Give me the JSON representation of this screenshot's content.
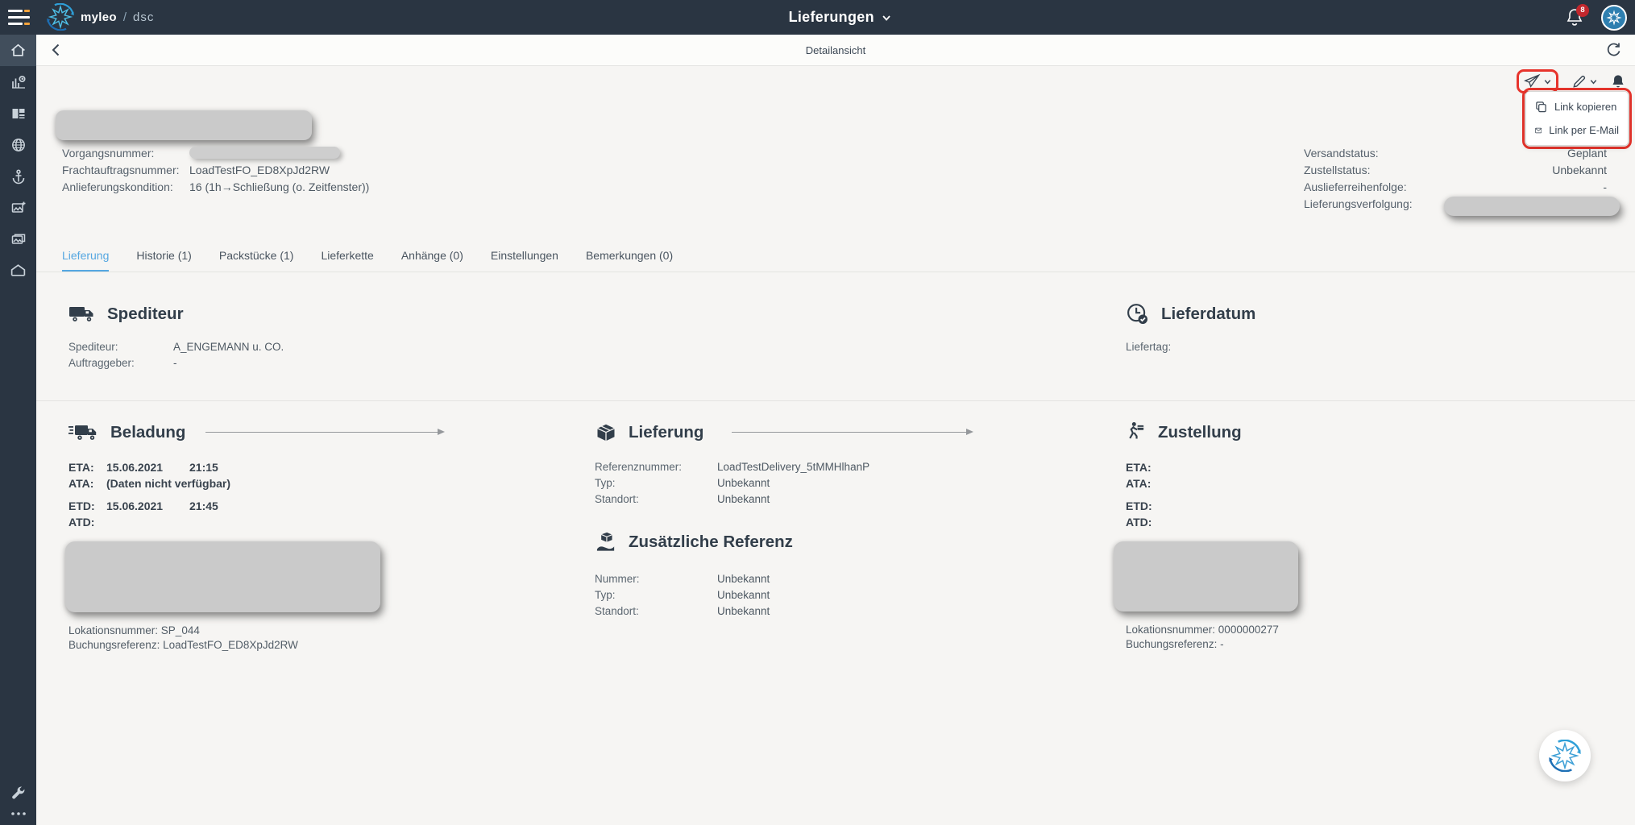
{
  "colors": {
    "topbar_bg": "#2a3542",
    "accent_blue": "#55a7e1",
    "annotation_red": "#e7342c",
    "badge_red": "#c1272d",
    "brand_orange": "#f2a33c"
  },
  "topbar": {
    "brand_name": "myleo",
    "brand_sep": "/",
    "brand_product": "dsc",
    "title": "Lieferungen",
    "notifications_count": "8"
  },
  "sidebar": {
    "items": [
      {
        "name": "home"
      },
      {
        "name": "analytics"
      },
      {
        "name": "boards"
      },
      {
        "name": "globe"
      },
      {
        "name": "anchor"
      },
      {
        "name": "image-add"
      },
      {
        "name": "gallery"
      },
      {
        "name": "warehouse"
      }
    ]
  },
  "subheader": {
    "title": "Detailansicht"
  },
  "share_menu": {
    "items": [
      {
        "label": "Link kopieren"
      },
      {
        "label": "Link per E-Mail"
      }
    ]
  },
  "info": {
    "left": [
      {
        "label": "Vorgangsnummer:",
        "value": ""
      },
      {
        "label": "Frachtauftragsnummer:",
        "value": "LoadTestFO_ED8XpJd2RW"
      },
      {
        "label": "Anlieferungskondition:",
        "value": "16 (1h→Schließung (o. Zeitfenster))"
      }
    ],
    "right": [
      {
        "label": "Versandstatus:",
        "value": "Geplant"
      },
      {
        "label": "Zustellstatus:",
        "value": "Unbekannt"
      },
      {
        "label": "Auslieferreihenfolge:",
        "value": "-"
      },
      {
        "label": "Lieferungsverfolgung:",
        "value": ""
      }
    ]
  },
  "tabs": [
    {
      "label": "Lieferung",
      "active": true
    },
    {
      "label": "Historie (1)",
      "active": false
    },
    {
      "label": "Packstücke (1)",
      "active": false
    },
    {
      "label": "Lieferkette",
      "active": false
    },
    {
      "label": "Anhänge (0)",
      "active": false
    },
    {
      "label": "Einstellungen",
      "active": false
    },
    {
      "label": "Bemerkungen (0)",
      "active": false
    }
  ],
  "sections": {
    "spediteur": {
      "title": "Spediteur",
      "rows": [
        {
          "label": "Spediteur:",
          "value": "A_ENGEMANN u. CO."
        },
        {
          "label": "Auftraggeber:",
          "value": "-"
        }
      ]
    },
    "lieferdatum": {
      "title": "Lieferdatum",
      "rows": [
        {
          "label": "Liefertag:",
          "value": ""
        }
      ]
    },
    "beladung": {
      "title": "Beladung",
      "times": [
        {
          "label": "ETA:",
          "date": "15.06.2021",
          "time": "21:15"
        },
        {
          "label": "ATA:",
          "date": "(Daten nicht verfügbar)",
          "time": ""
        },
        {
          "label": "ETD:",
          "date": "15.06.2021",
          "time": "21:45"
        },
        {
          "label": "ATD:",
          "date": "",
          "time": ""
        }
      ],
      "lokationsnummer": "Lokationsnummer: SP_044",
      "buchungsreferenz": "Buchungsreferenz: LoadTestFO_ED8XpJd2RW"
    },
    "lieferung": {
      "title": "Lieferung",
      "rows": [
        {
          "label": "Referenznummer:",
          "value": "LoadTestDelivery_5tMMHlhanP"
        },
        {
          "label": "Typ:",
          "value": "Unbekannt"
        },
        {
          "label": "Standort:",
          "value": "Unbekannt"
        }
      ]
    },
    "zusaetzliche_referenz": {
      "title": "Zusätzliche Referenz",
      "rows": [
        {
          "label": "Nummer:",
          "value": "Unbekannt"
        },
        {
          "label": "Typ:",
          "value": "Unbekannt"
        },
        {
          "label": "Standort:",
          "value": "Unbekannt"
        }
      ]
    },
    "zustellung": {
      "title": "Zustellung",
      "times": [
        {
          "label": "ETA:"
        },
        {
          "label": "ATA:"
        },
        {
          "label": "ETD:"
        },
        {
          "label": "ATD:"
        }
      ],
      "lokationsnummer": "Lokationsnummer: 0000000277",
      "buchungsreferenz": "Buchungsreferenz: -"
    }
  }
}
